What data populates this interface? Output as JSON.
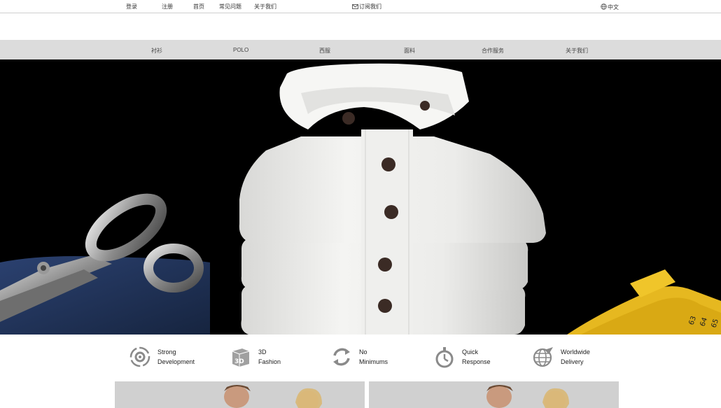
{
  "topbar": {
    "login": "登录",
    "register": "注册",
    "home": "首页",
    "faq": "常见问题",
    "about": "关于我们",
    "subscribe": "订阅我们",
    "language": "中文"
  },
  "nav": {
    "items": [
      {
        "label": "衬衫"
      },
      {
        "label": "POLO"
      },
      {
        "label": "西服"
      },
      {
        "label": "面料"
      },
      {
        "label": "合作服务"
      },
      {
        "label": "关于我们"
      }
    ]
  },
  "hero": {
    "description": "",
    "tape_numbers": [
      "65",
      "64",
      "63"
    ]
  },
  "features": [
    {
      "line1": "Strong",
      "line2": "Development",
      "icon": "gear-arrows-icon"
    },
    {
      "line1": "3D",
      "line2": "Fashion",
      "icon": "3d-cube-icon"
    },
    {
      "line1": "No",
      "line2": "Minimums",
      "icon": "cycle-arrows-icon"
    },
    {
      "line1": "Quick",
      "line2": "Response",
      "icon": "stopwatch-icon"
    },
    {
      "line1": "Worldwide",
      "line2": "Delivery",
      "icon": "globe-plane-icon"
    }
  ],
  "icon_text": {
    "cube_label": "3D"
  },
  "colors": {
    "nav_bg": "#dcdcdc",
    "hero_bg": "#000000",
    "icon_gray": "#8a8a8a",
    "tape_yellow": "#e6b820",
    "cloth_blue": "#1f3457"
  }
}
